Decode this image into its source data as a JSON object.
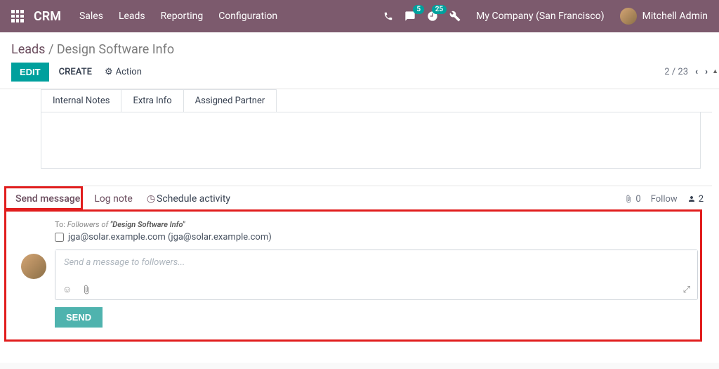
{
  "topbar": {
    "brand": "CRM",
    "nav": [
      "Sales",
      "Leads",
      "Reporting",
      "Configuration"
    ],
    "msg_badge": "5",
    "activity_badge": "25",
    "company": "My Company (San Francisco)",
    "user": "Mitchell Admin"
  },
  "breadcrumb": {
    "parent": "Leads",
    "current": "Design Software Info"
  },
  "actions": {
    "edit": "EDIT",
    "create": "CREATE",
    "action": "Action",
    "pager": "2 / 23"
  },
  "tabs": [
    "Internal Notes",
    "Extra Info",
    "Assigned Partner"
  ],
  "chatter": {
    "send_message": "Send message",
    "log_note": "Log note",
    "schedule": "Schedule activity",
    "attach_count": "0",
    "follow": "Follow",
    "followers_count": "2",
    "to_prefix": "To:",
    "to_body": "Followers of",
    "to_record": "\"Design Software Info\"",
    "suggestion": "jga@solar.example.com (jga@solar.example.com)",
    "placeholder": "Send a message to followers...",
    "send_btn": "SEND"
  }
}
